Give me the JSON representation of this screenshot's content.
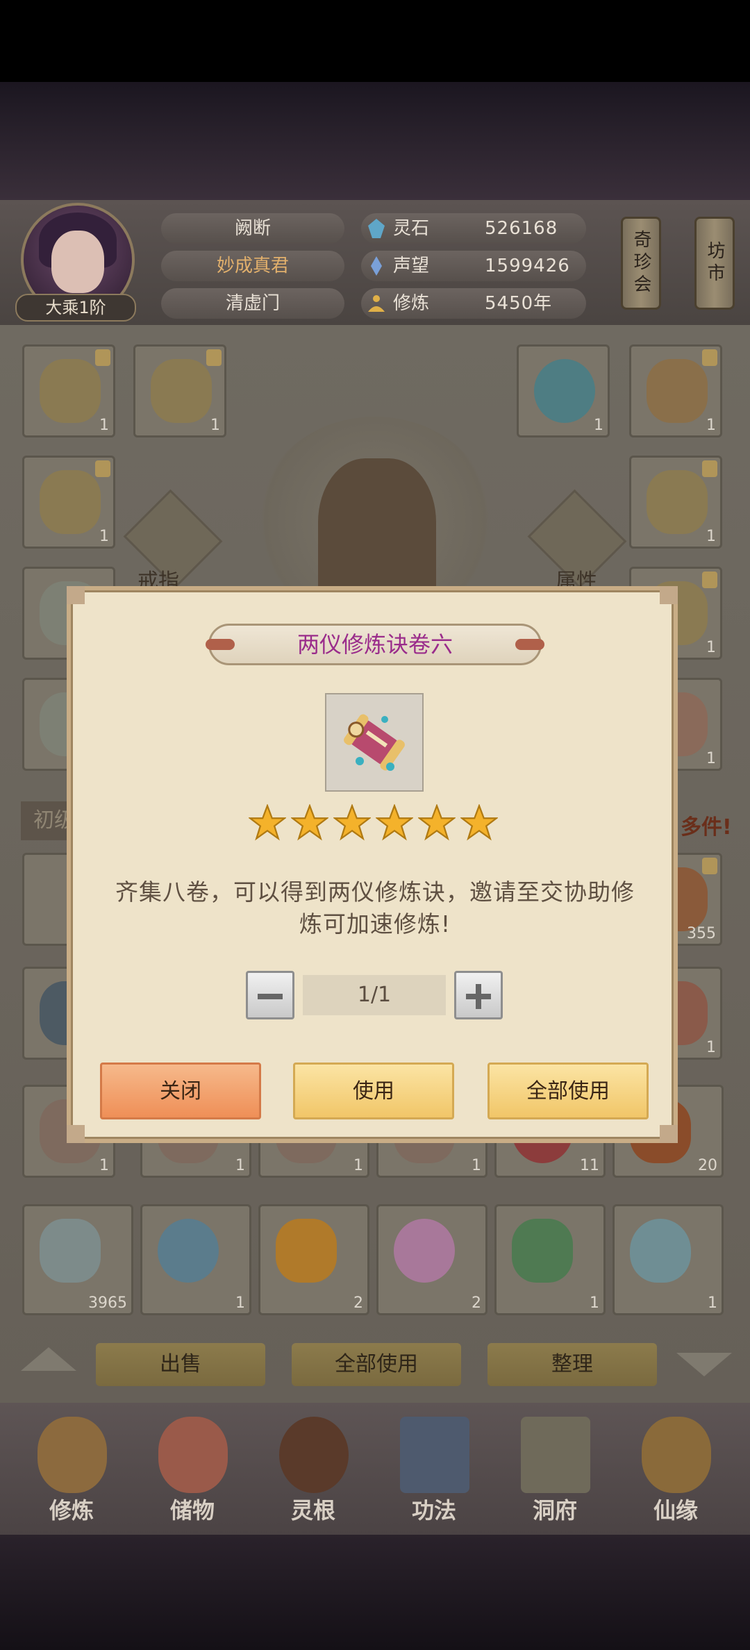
{
  "header": {
    "player_name": "阙断",
    "title": "妙成真君",
    "sect": "清虚门",
    "realm": "大乘1阶",
    "resources": [
      {
        "icon": "spirit-stone-icon",
        "label": "灵石",
        "value": "526168"
      },
      {
        "icon": "reputation-icon",
        "label": "声望",
        "value": "1599426"
      },
      {
        "icon": "cultivation-icon",
        "label": "修炼",
        "value": "5450年"
      }
    ],
    "side_buttons": [
      "奇珍会",
      "坊市"
    ]
  },
  "background": {
    "equip_labels": [
      "戒指",
      "属性"
    ],
    "tab_partial": "初级",
    "notice_partial": "多件!",
    "grid_counts": [
      "1",
      "1",
      "1",
      "1",
      "1",
      "1",
      "1",
      "1",
      "355",
      "1",
      "1",
      "1",
      "1",
      "1",
      "11",
      "20",
      "3965",
      "1",
      "2",
      "2",
      "1",
      "1"
    ],
    "actions": [
      "出售",
      "全部使用",
      "整理"
    ]
  },
  "nav": [
    {
      "icon": "cultivate-icon",
      "label": "修炼"
    },
    {
      "icon": "storage-bag-icon",
      "label": "储物"
    },
    {
      "icon": "spirit-root-icon",
      "label": "灵根"
    },
    {
      "icon": "technique-book-icon",
      "label": "功法"
    },
    {
      "icon": "cave-dwelling-icon",
      "label": "洞府"
    },
    {
      "icon": "fate-icon",
      "label": "仙缘"
    }
  ],
  "modal": {
    "title": "两仪修炼诀卷六",
    "item_icon": "scroll-icon",
    "stars": 6,
    "description": "齐集八卷，可以得到两仪修炼诀，邀请至交协助修炼可加速修炼!",
    "quantity": "1/1",
    "buttons": {
      "close": "关闭",
      "use": "使用",
      "use_all": "全部使用"
    }
  },
  "colors": {
    "modal_bg": "#eee3c9",
    "title_text": "#9a2c8b",
    "star": "#f4b22b",
    "close_button": "#ef8f57",
    "use_button": "#f1c668"
  }
}
